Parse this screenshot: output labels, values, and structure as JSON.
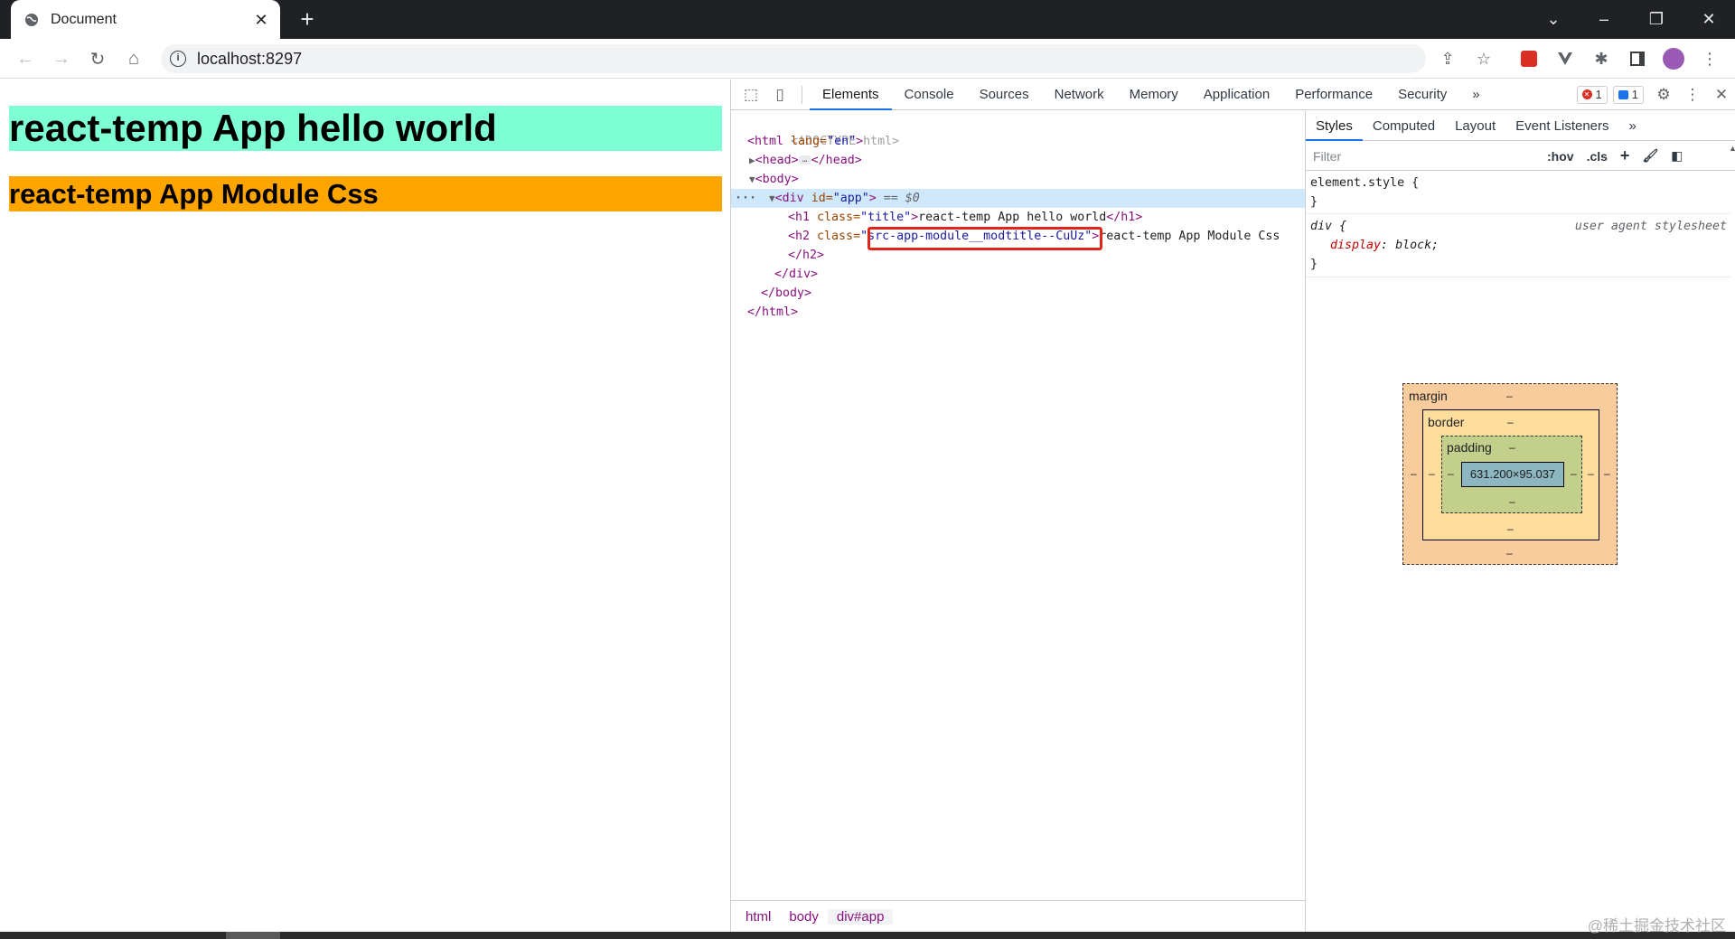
{
  "browser": {
    "tab_title": "Document",
    "url": "localhost:8297"
  },
  "page": {
    "h1_text": "react-temp App hello world",
    "h2_text": "react-temp App Module Css",
    "h1_bg": "#7fffd4",
    "h2_bg": "#ffa500"
  },
  "devtools": {
    "tabs": [
      "Elements",
      "Console",
      "Sources",
      "Network",
      "Memory",
      "Application",
      "Performance",
      "Security"
    ],
    "more": "»",
    "error_count": "1",
    "message_count": "1",
    "dom": {
      "doctype": "<!DOCTYPE html>",
      "html_open": "<html",
      "html_lang_attr": " lang=",
      "html_lang_val": "\"en\"",
      "gt": ">",
      "head_open": "<head>",
      "head_close": "</head>",
      "body_open": "<body>",
      "div_open": "<div",
      "div_id_attr": " id=",
      "div_id_val": "\"app\"",
      "div_marker": " == $0",
      "h1_open": "<h1",
      "h1_class_attr": " class=",
      "h1_class_val": "\"title\"",
      "h1_text": "react-temp App hello world",
      "h1_close": "</h1>",
      "h2_open": "<h2",
      "h2_class_attr": " class=",
      "h2_class_quote": "\"",
      "h2_class_val": "src-app-module__modtitle--CuUz",
      "h2_text": "react-temp App Module Css",
      "h2_close": "</h2>",
      "div_close": "</div>",
      "body_close": "</body>",
      "html_close": "</html>",
      "line_menu": "···"
    },
    "breadcrumbs": [
      "html",
      "body",
      "div#app"
    ],
    "sidebar": {
      "tabs": [
        "Styles",
        "Computed",
        "Layout",
        "Event Listeners"
      ],
      "filter_placeholder": "Filter",
      "hov": ":hov",
      "cls": ".cls",
      "rules": {
        "element_style": "element.style {",
        "close_brace": "}",
        "div_selector": "div {",
        "div_source": "user agent stylesheet",
        "display_prop": "display",
        "display_val": "block;"
      },
      "box_model": {
        "margin_label": "margin",
        "border_label": "border",
        "padding_label": "padding",
        "content_size": "631.200×95.037",
        "dash": "–"
      }
    }
  },
  "watermark": "@稀土掘金技术社区"
}
